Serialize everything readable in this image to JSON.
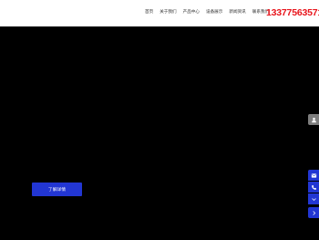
{
  "nav": {
    "items": [
      {
        "label": "首页"
      },
      {
        "label": "关于我们"
      },
      {
        "label": "产品中心"
      },
      {
        "label": "设备展示"
      },
      {
        "label": "新闻资讯"
      },
      {
        "label": "联系我们"
      }
    ],
    "phone": "13377563571"
  },
  "hero": {
    "cta_label": "了解详情"
  },
  "sidebar": {
    "buttons": [
      {
        "icon": "person-icon",
        "color": "#7d7d7d"
      },
      {
        "icon": "message-icon",
        "color": "#2236d3"
      },
      {
        "icon": "phone-icon",
        "color": "#2236d3"
      },
      {
        "icon": "chevron-down-icon",
        "color": "#2236d3"
      },
      {
        "icon": "chevron-right-icon",
        "color": "#2236d3"
      }
    ]
  },
  "colors": {
    "accent": "#2236d3",
    "phone": "#e8141b",
    "background": "#000000",
    "header": "#ffffff"
  }
}
